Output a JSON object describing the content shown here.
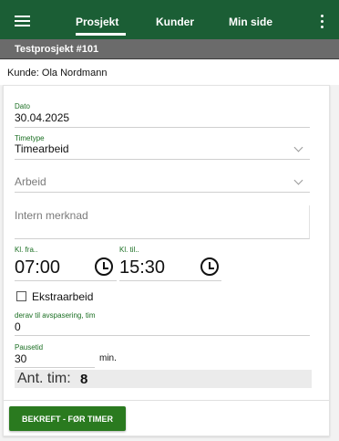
{
  "nav": {
    "tabs": [
      {
        "label": "Prosjekt",
        "active": true
      },
      {
        "label": "Kunder",
        "active": false
      },
      {
        "label": "Min side",
        "active": false
      }
    ]
  },
  "project": {
    "title": "Testprosjekt #101"
  },
  "customer": {
    "text": "Kunde: Ola Nordmann"
  },
  "form": {
    "date": {
      "label": "Dato",
      "value": "30.04.2025"
    },
    "timetype": {
      "label": "Timetype",
      "value": "Timearbeid"
    },
    "work": {
      "placeholder": "Arbeid"
    },
    "note": {
      "placeholder": "Intern merknad"
    },
    "from": {
      "label": "Kl. fra..",
      "value": "07:00"
    },
    "to": {
      "label": "Kl. til..",
      "value": "15:30"
    },
    "extra": {
      "label": "Ekstraarbeid",
      "checked": false
    },
    "comp": {
      "label": "derav til avspasering, tim",
      "value": "0"
    },
    "pause": {
      "label": "Pausetid",
      "value": "30",
      "unit": "min."
    },
    "total": {
      "label": "Ant. tim:",
      "value": "8"
    },
    "confirm": {
      "label": "BEKREFT - FØR TIMER"
    }
  },
  "colors": {
    "topbar": "#1b5e35",
    "accent": "#2a7a1f",
    "label": "#1b6f23"
  }
}
